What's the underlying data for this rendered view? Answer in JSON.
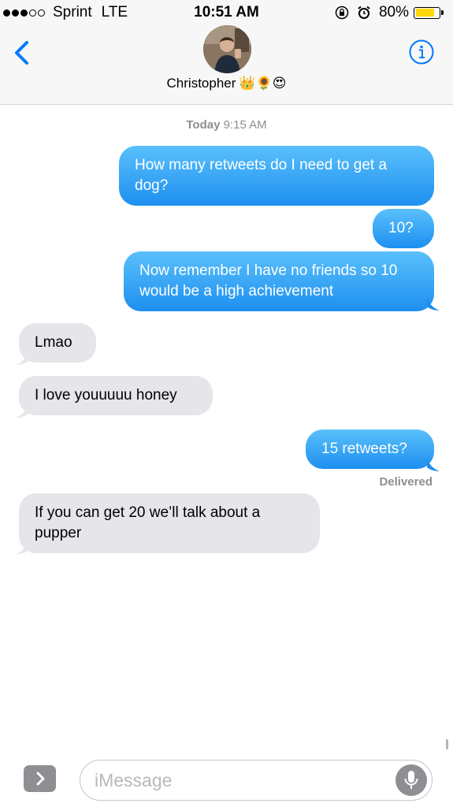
{
  "status_bar": {
    "carrier": "Sprint",
    "network": "LTE",
    "time": "10:51 AM",
    "battery_percent": "80%",
    "battery_level": 0.8,
    "icons": [
      "signal-dots-icon",
      "orientation-lock-icon",
      "alarm-icon",
      "battery-icon"
    ],
    "colors": {
      "battery": "#ffd80a"
    }
  },
  "header": {
    "contact_name": "Christopher",
    "contact_emoji": "👑🌻😍",
    "back_icon": "chevron-left-icon",
    "info_icon": "info-icon"
  },
  "thread": {
    "timestamp_day": "Today",
    "timestamp_time": "9:15 AM",
    "messages": [
      {
        "direction": "outgoing",
        "text": "How many retweets do I need to get a dog?"
      },
      {
        "direction": "outgoing",
        "text": "10?"
      },
      {
        "direction": "outgoing",
        "text": "Now remember I have no friends so 10 would be a high achievement"
      },
      {
        "direction": "incoming",
        "text": "Lmao"
      },
      {
        "direction": "incoming",
        "text": "I love youuuuu honey"
      },
      {
        "direction": "outgoing",
        "text": "15 retweets?"
      },
      {
        "direction": "incoming",
        "text": "If you can get 20 we’ll talk about a pupper"
      }
    ],
    "delivered_label": "Delivered"
  },
  "compose": {
    "apps_icon": "chevron-right-icon",
    "placeholder": "iMessage",
    "value": "",
    "mic_icon": "microphone-icon"
  },
  "colors": {
    "accent": "#007aff",
    "outgoing_bubble": "#2196f3",
    "incoming_bubble": "#e5e5ea",
    "header_bg": "#f7f7f7",
    "secondary_text": "#8e8e93"
  }
}
